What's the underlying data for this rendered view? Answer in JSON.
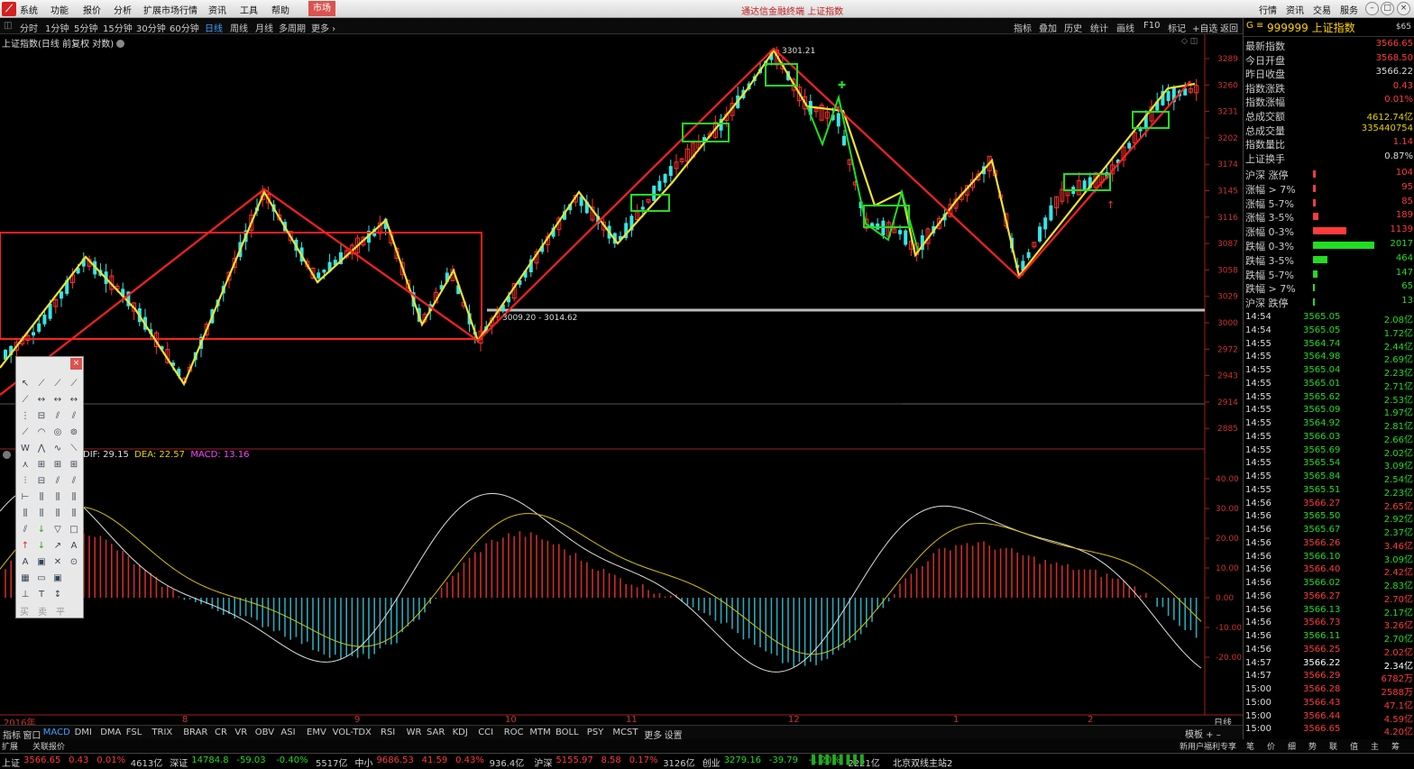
{
  "menubar": {
    "items": [
      "系统",
      "功能",
      "报价",
      "分析",
      "扩展市场行情",
      "资讯",
      "工具",
      "帮助"
    ],
    "active": "市场",
    "title_main": "通达信金融终端",
    "title_sub": "上证指数",
    "right": [
      "行情",
      "资讯",
      "交易",
      "服务"
    ]
  },
  "periods": [
    "分时",
    "1分钟",
    "5分钟",
    "15分钟",
    "30分钟",
    "60分钟",
    "日线",
    "周线",
    "月线",
    "多周期",
    "更多"
  ],
  "active_period": "日线",
  "tools": [
    "指标",
    "叠加",
    "历史",
    "统计",
    "画线",
    "F10",
    "标记",
    "+自选",
    "返回"
  ],
  "chart": {
    "title": "上证指数(日线 前复权 对数)",
    "peak_label": "3301.21",
    "range_label": "3009.20 - 3014.62",
    "price_ticks": [
      "3289",
      "3260",
      "3231",
      "3202",
      "3174",
      "3145",
      "3116",
      "3087",
      "3058",
      "3029",
      "3000",
      "2972",
      "2943",
      "2914",
      "2885"
    ],
    "macd_ticks": [
      "40.00",
      "30.00",
      "20.00",
      "10.00",
      "0.00",
      "-10.00",
      "-20.00"
    ],
    "x_labels": [
      "2016年",
      "8",
      "9",
      "10",
      "11",
      "12",
      "1",
      "2"
    ],
    "period_label": "日线"
  },
  "macd": {
    "dif_label": "DIF: 29.15",
    "dea_label": "DEA: 22.57",
    "macd_label": "MACD: 13.16"
  },
  "indicators": [
    "指标",
    "窗口",
    "MACD",
    "DMI",
    "DMA",
    "FSL",
    "TRIX",
    "BRAR",
    "CR",
    "VR",
    "OBV",
    "ASI",
    "EMV",
    "VOL-TDX",
    "RSI",
    "WR",
    "SAR",
    "KDJ",
    "CCI",
    "ROC",
    "MTM",
    "BOLL",
    "PSY",
    "MCST",
    "更多",
    "设置"
  ],
  "active_indicator": "MACD",
  "bottom_right": "模板",
  "bottom2": [
    "扩展",
    "关联报价"
  ],
  "bottom2_right": "新用户福利专享",
  "bottom2_icons": [
    "笔",
    "价",
    "细",
    "势",
    "联",
    "值",
    "主",
    "筹"
  ],
  "right_panel": {
    "code": "999999",
    "name": "上证指数",
    "badge": "$65",
    "stats": [
      {
        "label": "最新指数",
        "value": "3566.65",
        "color": "#ff3b3b"
      },
      {
        "label": "今日开盘",
        "value": "3568.50",
        "color": "#ff3b3b"
      },
      {
        "label": "昨日收盘",
        "value": "3566.22",
        "color": "#dddddd"
      },
      {
        "label": "指数涨跌",
        "value": "0.43",
        "color": "#ff3b3b"
      },
      {
        "label": "指数涨幅",
        "value": "0.01%",
        "color": "#ff3b3b"
      },
      {
        "label": "总成交额",
        "value": "4612.74亿",
        "color": "#e8d200"
      },
      {
        "label": "总成交量",
        "value": "335440754",
        "color": "#e8d200"
      },
      {
        "label": "指数量比",
        "value": "1.14",
        "color": "#ff3b3b"
      },
      {
        "label": "上证换手",
        "value": "0.87%",
        "color": "#dddddd"
      }
    ],
    "breadth": [
      {
        "label": "沪深 涨停",
        "value": "104",
        "color": "#ff3b3b",
        "bar": 0.05
      },
      {
        "label": "涨幅 > 7%",
        "value": "95",
        "color": "#ff3b3b",
        "bar": 0.04
      },
      {
        "label": "涨幅 5-7%",
        "value": "85",
        "color": "#ff3b3b",
        "bar": 0.04
      },
      {
        "label": "涨幅 3-5%",
        "value": "189",
        "color": "#ff3b3b",
        "bar": 0.09
      },
      {
        "label": "涨幅 0-3%",
        "value": "1139",
        "color": "#ff3b3b",
        "bar": 0.55
      },
      {
        "label": "跌幅 0-3%",
        "value": "2017",
        "color": "#22dd22",
        "bar": 1.0
      },
      {
        "label": "跌幅 3-5%",
        "value": "464",
        "color": "#22dd22",
        "bar": 0.23
      },
      {
        "label": "跌幅 5-7%",
        "value": "147",
        "color": "#22dd22",
        "bar": 0.07
      },
      {
        "label": "跌幅 > 7%",
        "value": "65",
        "color": "#22dd22",
        "bar": 0.03
      },
      {
        "label": "沪深 跌停",
        "value": "13",
        "color": "#22dd22",
        "bar": 0.01
      }
    ],
    "ticks": [
      {
        "t": "14:54",
        "p": "3565.05",
        "v": "2.08亿",
        "c": "#22dd22"
      },
      {
        "t": "14:54",
        "p": "3565.05",
        "v": "1.72亿",
        "c": "#22dd22"
      },
      {
        "t": "14:55",
        "p": "3564.74",
        "v": "2.44亿",
        "c": "#22dd22"
      },
      {
        "t": "14:55",
        "p": "3564.98",
        "v": "2.69亿",
        "c": "#22dd22"
      },
      {
        "t": "14:55",
        "p": "3565.04",
        "v": "2.23亿",
        "c": "#22dd22"
      },
      {
        "t": "14:55",
        "p": "3565.01",
        "v": "2.71亿",
        "c": "#22dd22"
      },
      {
        "t": "14:55",
        "p": "3565.62",
        "v": "2.53亿",
        "c": "#22dd22"
      },
      {
        "t": "14:55",
        "p": "3565.09",
        "v": "1.97亿",
        "c": "#22dd22"
      },
      {
        "t": "14:55",
        "p": "3564.92",
        "v": "2.81亿",
        "c": "#22dd22"
      },
      {
        "t": "14:55",
        "p": "3566.03",
        "v": "2.66亿",
        "c": "#22dd22"
      },
      {
        "t": "14:55",
        "p": "3565.69",
        "v": "2.02亿",
        "c": "#22dd22"
      },
      {
        "t": "14:55",
        "p": "3565.54",
        "v": "3.09亿",
        "c": "#22dd22"
      },
      {
        "t": "14:55",
        "p": "3565.84",
        "v": "2.54亿",
        "c": "#22dd22"
      },
      {
        "t": "14:55",
        "p": "3565.51",
        "v": "2.23亿",
        "c": "#22dd22"
      },
      {
        "t": "14:56",
        "p": "3566.27",
        "v": "2.65亿",
        "c": "#ff3b3b"
      },
      {
        "t": "14:56",
        "p": "3565.50",
        "v": "2.92亿",
        "c": "#22dd22"
      },
      {
        "t": "14:56",
        "p": "3565.67",
        "v": "2.37亿",
        "c": "#22dd22"
      },
      {
        "t": "14:56",
        "p": "3566.26",
        "v": "3.46亿",
        "c": "#ff3b3b"
      },
      {
        "t": "14:56",
        "p": "3566.10",
        "v": "3.09亿",
        "c": "#22dd22"
      },
      {
        "t": "14:56",
        "p": "3566.40",
        "v": "2.42亿",
        "c": "#ff3b3b"
      },
      {
        "t": "14:56",
        "p": "3566.02",
        "v": "2.83亿",
        "c": "#22dd22"
      },
      {
        "t": "14:56",
        "p": "3566.27",
        "v": "2.70亿",
        "c": "#ff3b3b"
      },
      {
        "t": "14:56",
        "p": "3566.13",
        "v": "2.17亿",
        "c": "#22dd22"
      },
      {
        "t": "14:56",
        "p": "3566.73",
        "v": "3.26亿",
        "c": "#ff3b3b"
      },
      {
        "t": "14:56",
        "p": "3566.11",
        "v": "2.70亿",
        "c": "#22dd22"
      },
      {
        "t": "14:56",
        "p": "3566.25",
        "v": "2.02亿",
        "c": "#ff3b3b"
      },
      {
        "t": "14:57",
        "p": "3566.22",
        "v": "2.34亿",
        "c": "#ffffff"
      },
      {
        "t": "14:57",
        "p": "3566.29",
        "v": "6782万",
        "c": "#ff3b3b"
      },
      {
        "t": "15:00",
        "p": "3566.28",
        "v": "2588万",
        "c": "#ff3b3b"
      },
      {
        "t": "15:00",
        "p": "3566.43",
        "v": "47.1亿",
        "c": "#ff3b3b"
      },
      {
        "t": "15:00",
        "p": "3566.44",
        "v": "4.59亿",
        "c": "#ff3b3b"
      },
      {
        "t": "15:00",
        "p": "3566.65",
        "v": "4.20亿",
        "c": "#ff3b3b"
      }
    ]
  },
  "ticker": [
    {
      "name": "上证",
      "vals": [
        "3566.65",
        "0.43",
        "0.01%",
        "4613亿"
      ],
      "c": "#ff3b3b"
    },
    {
      "name": "深证",
      "vals": [
        "14784.8",
        "-59.03",
        "-0.40%",
        "5517亿"
      ],
      "c": "#22dd22"
    },
    {
      "name": "中小",
      "vals": [
        "9686.53",
        "41.59",
        "0.43%",
        "936.4亿"
      ],
      "c": "#ff3b3b"
    },
    {
      "name": "沪深",
      "vals": [
        "5155.97",
        "8.58",
        "0.17%",
        "3126亿"
      ],
      "c": "#ff3b3b"
    },
    {
      "name": "创业",
      "vals": [
        "3279.16",
        "-39.79",
        "-1.20%",
        "2221亿"
      ],
      "c": "#22dd22"
    }
  ],
  "ticker_server": "北京双线主站2",
  "toolbox_footer": [
    "买",
    "卖",
    "平"
  ]
}
